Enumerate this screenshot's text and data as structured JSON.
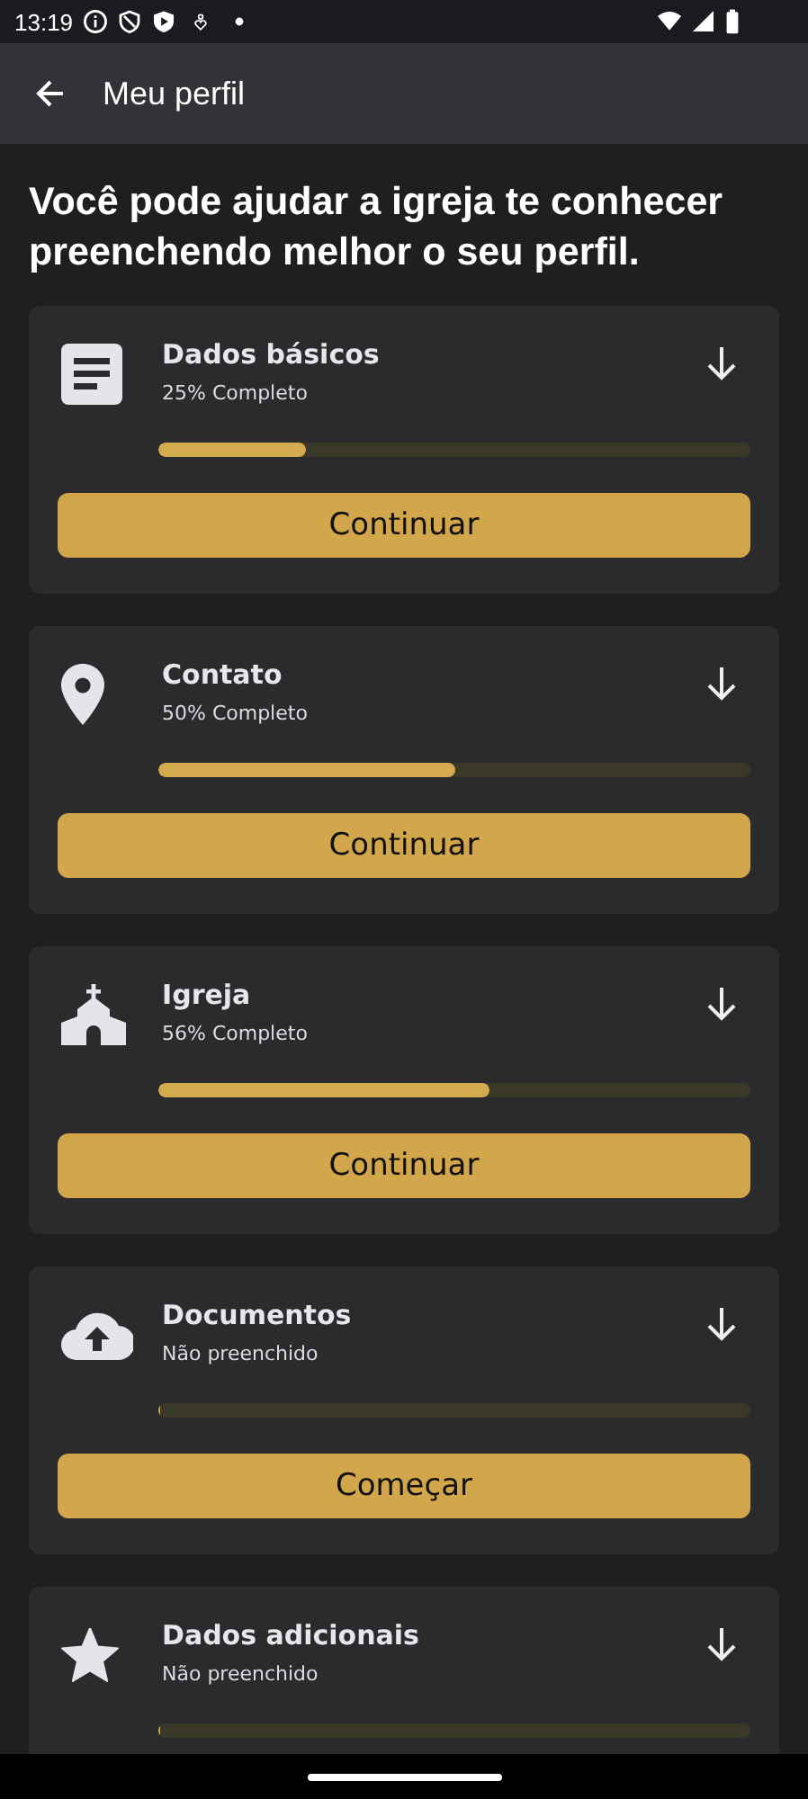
{
  "status_bar": {
    "time": "13:19"
  },
  "app_bar": {
    "title": "Meu perfil"
  },
  "heading": "Você pode ajudar a igreja te conhecer preenchendo melhor o seu perfil.",
  "sections": [
    {
      "title": "Dados básicos",
      "status": "25% Completo",
      "level": 0.25,
      "button": "Continuar"
    },
    {
      "title": "Contato",
      "status": "50% Completo",
      "level": 0.5,
      "button": "Continuar"
    },
    {
      "title": "Igreja",
      "status": "56% Completo",
      "level": 0.56,
      "button": "Continuar"
    },
    {
      "title": "Documentos",
      "status": "Não preenchido",
      "level": 0,
      "button": "Começar"
    },
    {
      "title": "Dados adicionais",
      "status": "Não preenchido",
      "level": 0
    }
  ]
}
